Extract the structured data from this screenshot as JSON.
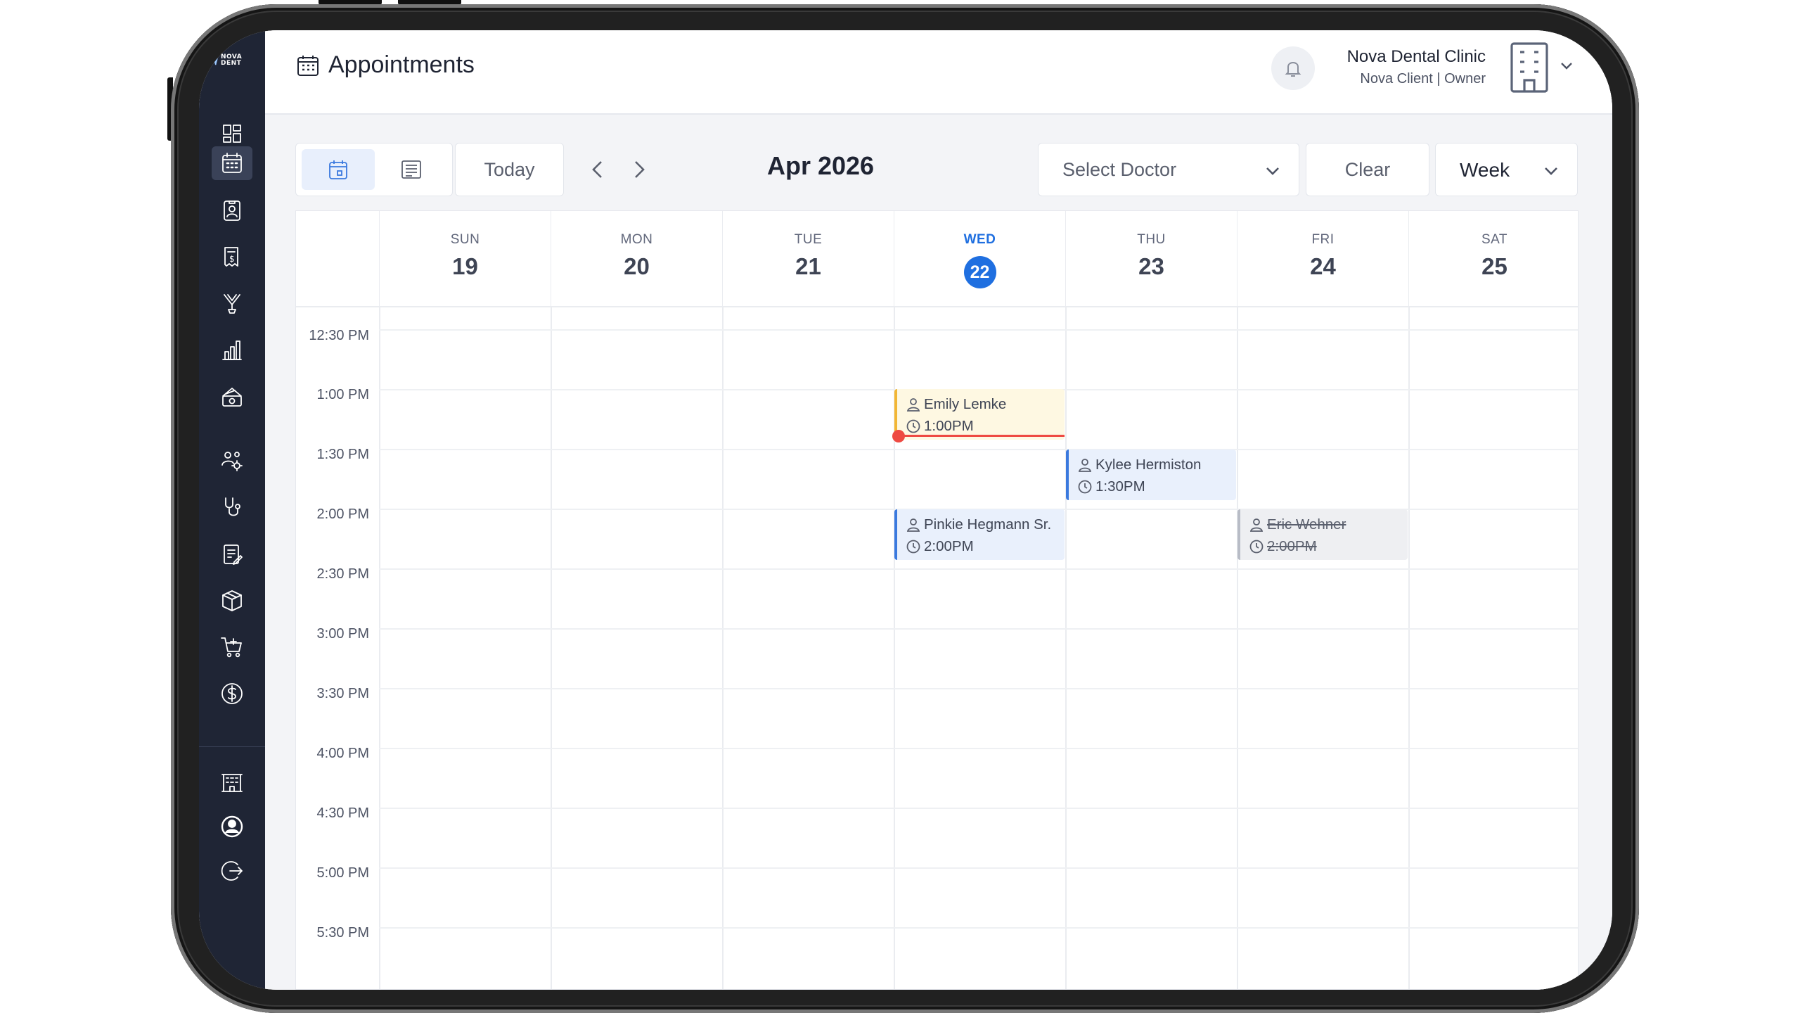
{
  "app": {
    "logo_text": "NOVA DENT",
    "page_title": "Appointments"
  },
  "header": {
    "clinic_name": "Nova Dental Clinic",
    "clinic_role": "Nova Client | Owner"
  },
  "sidebar": {
    "items": [
      {
        "name": "dashboard-icon",
        "active": false
      },
      {
        "name": "calendar-icon",
        "active": true
      },
      {
        "name": "patient-card-icon",
        "active": false
      },
      {
        "name": "invoice-icon",
        "active": false
      },
      {
        "name": "dental-tools-icon",
        "active": false
      },
      {
        "name": "bar-chart-icon",
        "active": false
      },
      {
        "name": "cash-register-icon",
        "active": false
      },
      {
        "name": "users-settings-icon",
        "active": false
      },
      {
        "name": "stethoscope-icon",
        "active": false
      },
      {
        "name": "clipboard-edit-icon",
        "active": false
      },
      {
        "name": "box-icon",
        "active": false
      },
      {
        "name": "cart-add-icon",
        "active": false
      },
      {
        "name": "dollar-icon",
        "active": false
      },
      {
        "name": "building-icon",
        "active": false
      },
      {
        "name": "user-circle-icon",
        "active": false
      },
      {
        "name": "logout-icon",
        "active": false
      }
    ]
  },
  "toolbar": {
    "today_label": "Today",
    "month_label": "Apr 2026",
    "doctor_placeholder": "Select Doctor",
    "clear_label": "Clear",
    "view_value": "Week"
  },
  "calendar": {
    "days": [
      {
        "name": "SUN",
        "num": "19",
        "today": false
      },
      {
        "name": "MON",
        "num": "20",
        "today": false
      },
      {
        "name": "TUE",
        "num": "21",
        "today": false
      },
      {
        "name": "WED",
        "num": "22",
        "today": true
      },
      {
        "name": "THU",
        "num": "23",
        "today": false
      },
      {
        "name": "FRI",
        "num": "24",
        "today": false
      },
      {
        "name": "SAT",
        "num": "25",
        "today": false
      }
    ],
    "times": [
      "12:30 PM",
      "1:00 PM",
      "1:30 PM",
      "2:00 PM",
      "2:30 PM",
      "3:00 PM",
      "3:30 PM",
      "4:00 PM",
      "4:30 PM",
      "5:00 PM",
      "5:30 PM"
    ],
    "events": [
      {
        "patient": "Emily Lemke",
        "time": "1:00PM",
        "status": "pending"
      },
      {
        "patient": "Kylee Hermiston",
        "time": "1:30PM",
        "status": "confirmed"
      },
      {
        "patient": "Pinkie Hegmann Sr.",
        "time": "2:00PM",
        "status": "confirmed"
      },
      {
        "patient": "Eric Wehner",
        "time": "2:00PM",
        "status": "cancelled"
      }
    ]
  },
  "colors": {
    "sidebar_bg": "#1f2535",
    "accent": "#1f6fe0",
    "pending": "#f2b633",
    "confirmed": "#3a79de",
    "cancelled": "#b8bcc6",
    "now_indicator": "#ee4a42"
  }
}
